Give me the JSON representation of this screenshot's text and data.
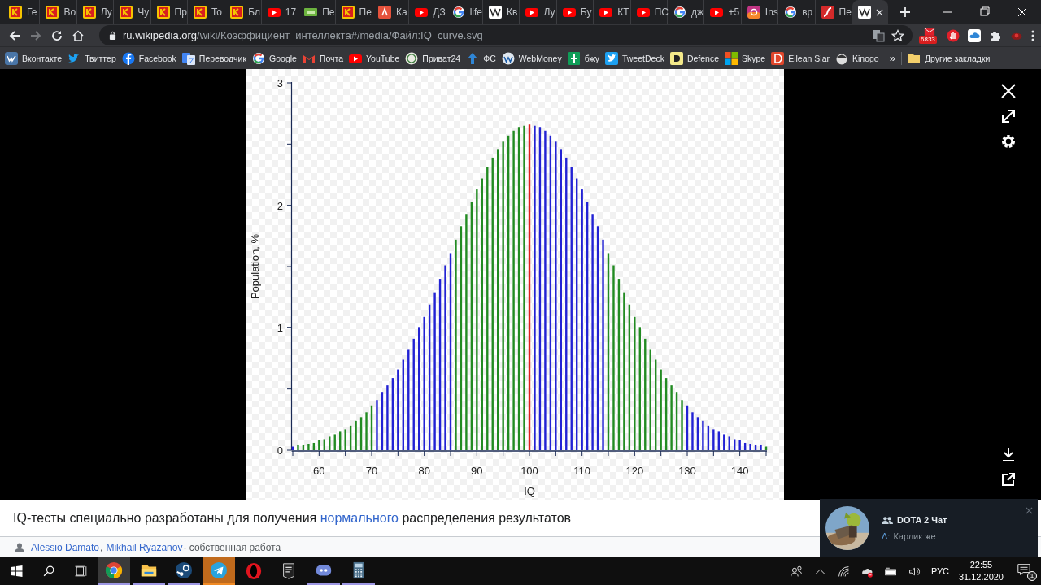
{
  "tabs": [
    {
      "title": "Ге",
      "kind": "k",
      "selected": false
    },
    {
      "title": "Во",
      "kind": "k",
      "selected": false
    },
    {
      "title": "Лу",
      "kind": "k",
      "selected": false
    },
    {
      "title": "Чу",
      "kind": "k",
      "selected": false
    },
    {
      "title": "Пр",
      "kind": "k",
      "selected": false
    },
    {
      "title": "То",
      "kind": "k",
      "selected": false
    },
    {
      "title": "Бл",
      "kind": "k",
      "selected": false
    },
    {
      "title": "17",
      "kind": "yt",
      "selected": false
    },
    {
      "title": "Пе",
      "kind": "hd",
      "selected": false
    },
    {
      "title": "Пе",
      "kind": "k",
      "selected": false
    },
    {
      "title": "Ка",
      "kind": "l",
      "selected": false
    },
    {
      "title": "ДЗ",
      "kind": "yt",
      "selected": false
    },
    {
      "title": "life",
      "kind": "g",
      "selected": false
    },
    {
      "title": "Кв",
      "kind": "w",
      "selected": false
    },
    {
      "title": "Лу",
      "kind": "yt",
      "selected": false
    },
    {
      "title": "Бу",
      "kind": "yt",
      "selected": false
    },
    {
      "title": "КТ",
      "kind": "yt",
      "selected": false
    },
    {
      "title": "ПС",
      "kind": "yt",
      "selected": false
    },
    {
      "title": "дж",
      "kind": "g",
      "selected": false
    },
    {
      "title": "+5",
      "kind": "yt",
      "selected": false
    },
    {
      "title": "Ins",
      "kind": "ig",
      "selected": false
    },
    {
      "title": "вр",
      "kind": "g",
      "selected": false
    },
    {
      "title": "Пе",
      "kind": "flash",
      "selected": false
    },
    {
      "kind": "w",
      "selected": true
    }
  ],
  "address": {
    "host": "ru.wikipedia.org",
    "path": "/wiki/Коэффициент_интеллекта#/media/Файл:IQ_curve.svg"
  },
  "extensions": {
    "mail_badge": "6833"
  },
  "bookmarks": [
    {
      "label": "Вконтакте",
      "kind": "vk"
    },
    {
      "label": "Твиттер",
      "kind": "twitter"
    },
    {
      "label": "Facebook",
      "kind": "facebook"
    },
    {
      "label": "Переводчик",
      "kind": "translate"
    },
    {
      "label": "Google",
      "kind": "g"
    },
    {
      "label": "Почта",
      "kind": "gmail"
    },
    {
      "label": "YouTube",
      "kind": "yt"
    },
    {
      "label": "Приват24",
      "kind": "privat"
    },
    {
      "label": "ФС",
      "kind": "arrow"
    },
    {
      "label": "WebMoney",
      "kind": "webmoney"
    },
    {
      "label": "бжу",
      "kind": "sheets"
    },
    {
      "label": "TweetDeck",
      "kind": "twitter-square"
    },
    {
      "label": "Defence",
      "kind": "defence"
    },
    {
      "label": "Skype",
      "kind": "windows"
    },
    {
      "label": "Eilean Siar",
      "kind": "eilean"
    },
    {
      "label": "Kinogo",
      "kind": "kinogo"
    }
  ],
  "bookmarks_more": "»",
  "other_bookmarks": "Другие закладки",
  "viewer": {
    "chart_data": {
      "type": "bar",
      "xlabel": "IQ",
      "ylabel": "Population, %",
      "stacked": true,
      "x": [
        55,
        56,
        57,
        58,
        59,
        60,
        61,
        62,
        63,
        64,
        65,
        66,
        67,
        68,
        69,
        70,
        71,
        72,
        73,
        74,
        75,
        76,
        77,
        78,
        79,
        80,
        81,
        82,
        83,
        84,
        85,
        86,
        87,
        88,
        89,
        90,
        91,
        92,
        93,
        94,
        95,
        96,
        97,
        98,
        99,
        100,
        101,
        102,
        103,
        104,
        105,
        106,
        107,
        108,
        109,
        110,
        111,
        112,
        113,
        114,
        115,
        116,
        117,
        118,
        119,
        120,
        121,
        122,
        123,
        124,
        125,
        126,
        127,
        128,
        129,
        130,
        131,
        132,
        133,
        134,
        135,
        136,
        137,
        138,
        139,
        140,
        141,
        142,
        143,
        144,
        145
      ],
      "series": [
        {
          "color": "#228b22",
          "values": [
            null,
            0.04,
            0.04,
            0.05,
            0.06,
            0.08,
            0.09,
            0.11,
            0.13,
            0.15,
            0.17,
            0.2,
            0.24,
            0.27,
            0.31,
            0.36,
            null,
            null,
            null,
            null,
            null,
            null,
            null,
            null,
            null,
            null,
            null,
            null,
            null,
            null,
            null,
            1.72,
            1.83,
            1.93,
            2.03,
            2.13,
            2.22,
            2.31,
            2.39,
            2.46,
            2.52,
            2.57,
            2.61,
            2.64,
            2.65,
            null,
            null,
            null,
            null,
            null,
            null,
            null,
            null,
            null,
            null,
            null,
            null,
            null,
            null,
            null,
            1.61,
            1.51,
            1.4,
            1.29,
            1.19,
            1.09,
            1.0,
            0.91,
            0.82,
            0.74,
            0.66,
            0.59,
            0.53,
            0.47,
            0.41,
            null,
            null,
            null,
            null,
            null,
            null,
            null,
            null,
            null,
            null,
            null,
            null,
            null,
            null,
            null,
            0.03
          ]
        },
        {
          "color": "#2222d4",
          "values": [
            0.03,
            null,
            null,
            null,
            null,
            null,
            null,
            null,
            null,
            null,
            null,
            null,
            null,
            null,
            null,
            null,
            0.41,
            0.47,
            0.53,
            0.59,
            0.66,
            0.74,
            0.82,
            0.91,
            1.0,
            1.09,
            1.19,
            1.29,
            1.4,
            1.51,
            1.61,
            null,
            null,
            null,
            null,
            null,
            null,
            null,
            null,
            null,
            null,
            null,
            null,
            null,
            null,
            null,
            2.65,
            2.64,
            2.61,
            2.57,
            2.52,
            2.46,
            2.39,
            2.31,
            2.22,
            2.13,
            2.03,
            1.93,
            1.83,
            1.72,
            null,
            null,
            null,
            null,
            null,
            null,
            null,
            null,
            null,
            null,
            null,
            null,
            null,
            null,
            null,
            0.36,
            0.31,
            0.27,
            0.24,
            0.2,
            0.17,
            0.15,
            0.13,
            0.11,
            0.09,
            0.08,
            0.06,
            0.05,
            0.04,
            0.04,
            null
          ]
        },
        {
          "color": "#e02020",
          "values": [
            null,
            null,
            null,
            null,
            null,
            null,
            null,
            null,
            null,
            null,
            null,
            null,
            null,
            null,
            null,
            null,
            null,
            null,
            null,
            null,
            null,
            null,
            null,
            null,
            null,
            null,
            null,
            null,
            null,
            null,
            null,
            null,
            null,
            null,
            null,
            null,
            null,
            null,
            null,
            null,
            null,
            null,
            null,
            null,
            null,
            2.66,
            null,
            null,
            null,
            null,
            null,
            null,
            null,
            null,
            null,
            null,
            null,
            null,
            null,
            null,
            null,
            null,
            null,
            null,
            null,
            null,
            null,
            null,
            null,
            null,
            null,
            null,
            null,
            null,
            null,
            null,
            null,
            null,
            null,
            null,
            null,
            null,
            null,
            null,
            null,
            null,
            null,
            null,
            null,
            null,
            null
          ]
        }
      ],
      "xlim": [
        55,
        145
      ],
      "ylim": [
        0,
        3
      ],
      "xticks": [
        60,
        70,
        80,
        90,
        100,
        110,
        120,
        130,
        140
      ],
      "yticks": [
        0,
        1,
        2,
        3
      ]
    }
  },
  "caption": {
    "before": "IQ-тесты специально разработаны для получения",
    "link": "нормального",
    "after": "распределения результатов"
  },
  "attribution": {
    "authors": [
      "Alessio Damato",
      "Mikhail Ryazanov"
    ],
    "separator": ",",
    "note": "- собственная работа"
  },
  "notification": {
    "title": "DOTA 2 Чат",
    "sender": "Δ:",
    "message": "Карлик же"
  },
  "taskbar": {
    "apps": [
      {
        "kind": "chrome",
        "selected": true,
        "running": true,
        "attention": false
      },
      {
        "kind": "explorer",
        "selected": false,
        "running": true,
        "attention": false
      },
      {
        "kind": "steam",
        "selected": false,
        "running": true,
        "attention": false
      },
      {
        "kind": "telegram",
        "selected": false,
        "running": true,
        "attention": true
      },
      {
        "kind": "opera",
        "selected": false,
        "running": false,
        "attention": false
      },
      {
        "kind": "epic",
        "selected": false,
        "running": false,
        "attention": false
      },
      {
        "kind": "discord",
        "selected": false,
        "running": true,
        "attention": false
      },
      {
        "kind": "calculator",
        "selected": false,
        "running": true,
        "attention": false
      }
    ],
    "language": "РУС",
    "time": "22:55",
    "date": "31.12.2020",
    "notifications": "1"
  }
}
